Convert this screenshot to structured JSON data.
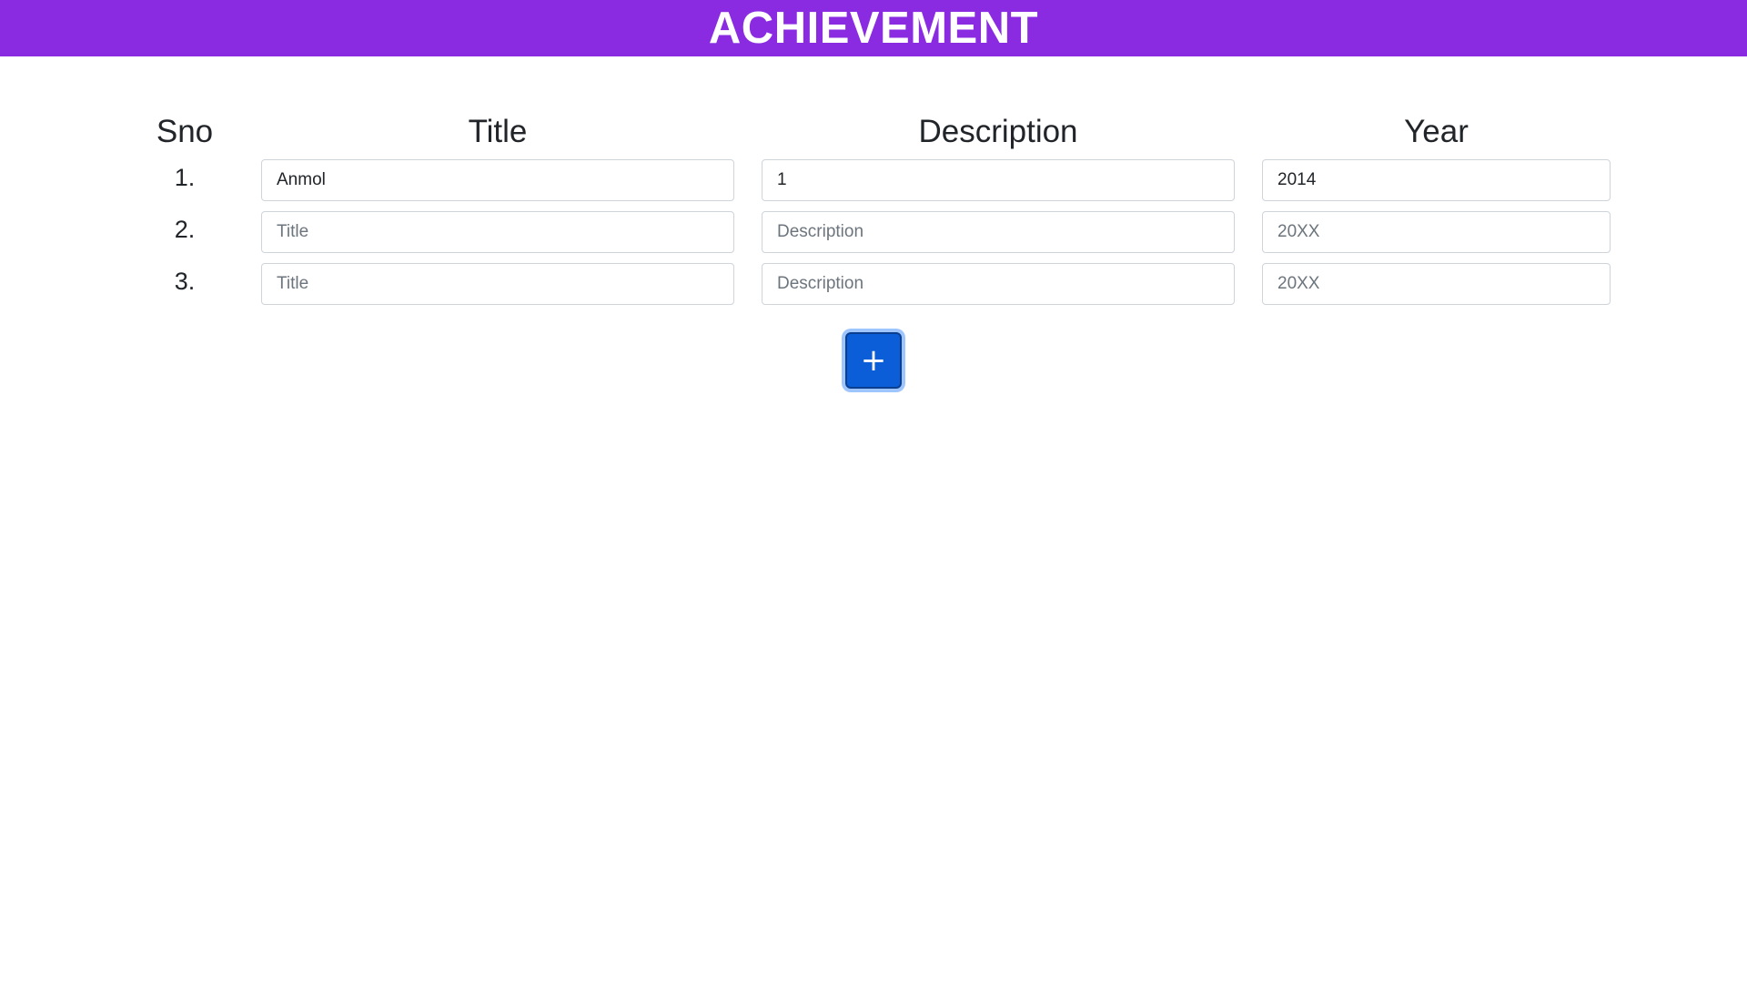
{
  "header": {
    "title": "ACHIEVEMENT"
  },
  "table": {
    "columns": [
      "Sno",
      "Title",
      "Description",
      "Year"
    ],
    "rows": [
      {
        "sno": "1.",
        "title": "Anmol",
        "description": "1",
        "year": "2014"
      },
      {
        "sno": "2.",
        "title": "",
        "description": "",
        "year": ""
      },
      {
        "sno": "3.",
        "title": "",
        "description": "",
        "year": ""
      }
    ],
    "placeholders": {
      "title": "Title",
      "description": "Description",
      "year": "20XX"
    }
  },
  "add_button": {
    "label": "+",
    "icon": "plus-icon"
  },
  "colors": {
    "header_bg": "#8a2be2",
    "button_bg": "#0b5ed7"
  }
}
